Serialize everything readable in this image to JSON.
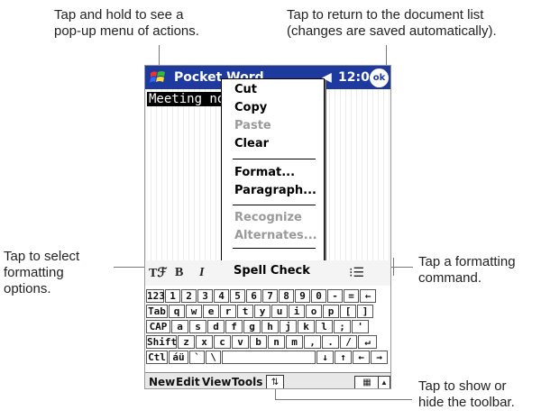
{
  "annotations": {
    "top_left": "Tap and hold to see a\npop-up menu of actions.",
    "top_right": "Tap to return to the document list\n(changes are saved automatically).",
    "left": "Tap to select\nformatting\noptions.",
    "right": "Tap a formatting\ncommand.",
    "bottom": "Tap to show or\nhide the toolbar."
  },
  "device": {
    "app_title": "Pocket Word",
    "clock": "12:06",
    "ok_label": "ok",
    "selected_text": "Meeting not"
  },
  "popup_menu": {
    "items": [
      {
        "label": "Cut",
        "enabled": true
      },
      {
        "label": "Copy",
        "enabled": true
      },
      {
        "label": "Paste",
        "enabled": false
      },
      {
        "label": "Clear",
        "enabled": true
      },
      {
        "label": "Format...",
        "enabled": true
      },
      {
        "label": "Paragraph...",
        "enabled": true
      },
      {
        "label": "Recognize",
        "enabled": false
      },
      {
        "label": "Alternates...",
        "enabled": false
      },
      {
        "label": "Spell Check",
        "enabled": true
      }
    ]
  },
  "toolbar": {
    "format_icon": "Tℱ",
    "bold": "B",
    "italic": "I",
    "list_icon": "⁝☰"
  },
  "keyboard": {
    "rows": [
      [
        "123",
        "1",
        "2",
        "3",
        "4",
        "5",
        "6",
        "7",
        "8",
        "9",
        "0",
        "-",
        "=",
        "←"
      ],
      [
        "Tab",
        "q",
        "w",
        "e",
        "r",
        "t",
        "y",
        "u",
        "i",
        "o",
        "p",
        "[",
        "]"
      ],
      [
        "CAP",
        "a",
        "s",
        "d",
        "f",
        "g",
        "h",
        "j",
        "k",
        "l",
        ";",
        "'"
      ],
      [
        "Shift",
        "z",
        "x",
        "c",
        "v",
        "b",
        "n",
        "m",
        ",",
        ".",
        "/",
        "↵"
      ],
      [
        "Ctl",
        "áü",
        "`",
        "\\",
        "space",
        "↓",
        "↑",
        "←",
        "→"
      ]
    ]
  },
  "menubar": {
    "new": "New",
    "edit": "Edit",
    "view": "View",
    "tools": "Tools"
  }
}
